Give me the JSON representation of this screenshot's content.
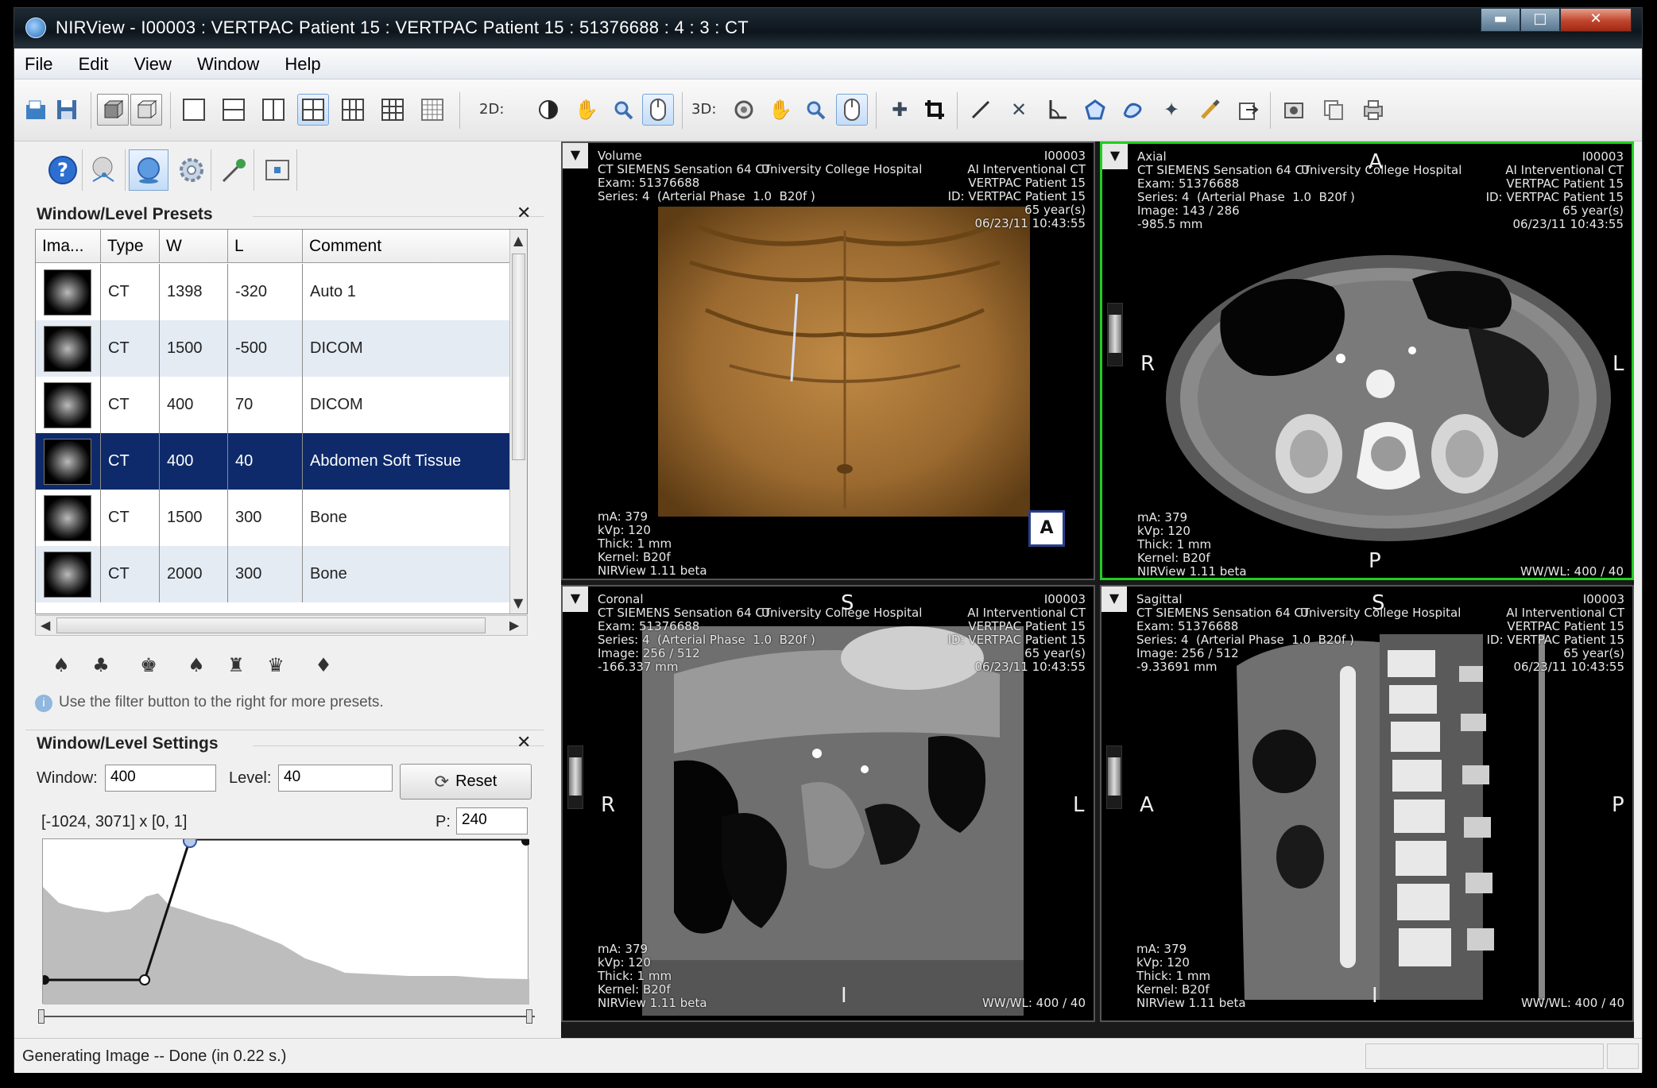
{
  "window": {
    "title": "NIRView - I00003 : VERTPAC Patient 15 : VERTPAC Patient 15 : 51376688 : 4  : 3  : CT"
  },
  "menu": [
    "File",
    "Edit",
    "View",
    "Window",
    "Help"
  ],
  "toolbar": {
    "label_2d": "2D:",
    "label_3d": "3D:"
  },
  "presets_panel": {
    "title": "Window/Level Presets",
    "columns": [
      "Ima...",
      "Type",
      "W",
      "L",
      "Comment"
    ],
    "rows": [
      {
        "type": "CT",
        "w": "1398",
        "l": "-320",
        "comment": "Auto 1"
      },
      {
        "type": "CT",
        "w": "1500",
        "l": "-500",
        "comment": "DICOM"
      },
      {
        "type": "CT",
        "w": "400",
        "l": "70",
        "comment": "DICOM"
      },
      {
        "type": "CT",
        "w": "400",
        "l": "40",
        "comment": "Abdomen Soft Tissue"
      },
      {
        "type": "CT",
        "w": "1500",
        "l": "300",
        "comment": "Bone"
      },
      {
        "type": "CT",
        "w": "2000",
        "l": "300",
        "comment": "Bone"
      }
    ],
    "selected_row": 3,
    "hint": "Use the filter button to the right for more presets."
  },
  "settings_panel": {
    "title": "Window/Level Settings",
    "window_label": "Window:",
    "window_value": "400",
    "level_label": "Level:",
    "level_value": "40",
    "reset_label": "Reset",
    "range_text": "[-1024, 3071] x [0, 1]",
    "p_label": "P:",
    "p_value": "240"
  },
  "viewports": {
    "volume": {
      "left": "Volume\nCT SIEMENS Sensation 64 CT\nExam: 51376688\nSeries: 4  (Arterial Phase  1.0  B20f )",
      "mid": "University College Hospital",
      "right": "I00003\nAI Interventional CT\nVERTPAC Patient 15\nID: VERTPAC Patient 15\n65 year(s)\n06/23/11 10:43:55",
      "bottom_left": "mA: 379\nkVp: 120\nThick: 1 mm\nKernel: B20f\nNIRView 1.11 beta",
      "badge": "A"
    },
    "axial": {
      "left": "Axial\nCT SIEMENS Sensation 64 CT\nExam: 51376688\nSeries: 4  (Arterial Phase  1.0  B20f )\nImage: 143 / 286\n-985.5 mm",
      "mid": "University College Hospital",
      "right": "I00003\nAI Interventional CT\nVERTPAC Patient 15\nID: VERTPAC Patient 15\n65 year(s)\n06/23/11 10:43:55",
      "bottom_left": "mA: 379\nkVp: 120\nThick: 1 mm\nKernel: B20f\nNIRView 1.11 beta",
      "bottom_right": "WW/WL: 400 / 40",
      "orient_top": "A",
      "orient_bottom": "P",
      "orient_left": "R",
      "orient_right": "L"
    },
    "coronal": {
      "left": "Coronal\nCT SIEMENS Sensation 64 CT\nExam: 51376688\nSeries: 4  (Arterial Phase  1.0  B20f )\nImage: 256 / 512\n-166.337 mm",
      "mid": "University College Hospital",
      "right": "I00003\nAI Interventional CT\nVERTPAC Patient 15\nID: VERTPAC Patient 15\n65 year(s)\n06/23/11 10:43:55",
      "bottom_left": "mA: 379\nkVp: 120\nThick: 1 mm\nKernel: B20f\nNIRView 1.11 beta",
      "bottom_right": "WW/WL: 400 / 40",
      "orient_top": "S",
      "orient_bottom": "I",
      "orient_left": "R",
      "orient_right": "L"
    },
    "sagittal": {
      "left": "Sagittal\nCT SIEMENS Sensation 64 CT\nExam: 51376688\nSeries: 4  (Arterial Phase  1.0  B20f )\nImage: 256 / 512\n-9.33691 mm",
      "mid": "University College Hospital",
      "right": "I00003\nAI Interventional CT\nVERTPAC Patient 15\nID: VERTPAC Patient 15\n65 year(s)\n06/23/11 10:43:55",
      "bottom_left": "mA: 379\nkVp: 120\nThick: 1 mm\nKernel: B20f\nNIRView 1.11 beta",
      "bottom_right": "WW/WL: 400 / 40",
      "orient_top": "S",
      "orient_bottom": "I",
      "orient_left": "A",
      "orient_right": "P"
    }
  },
  "status": {
    "text": "Generating Image -- Done (in 0.22 s.)"
  },
  "colors": {
    "active_viewport": "#20d020",
    "selection": "#0e2a6b",
    "alt_row": "#e4ebf3"
  },
  "icons": {
    "file_tools": [
      "open-icon",
      "save-icon"
    ],
    "left_tabs": [
      "help-icon",
      "transfer-function-icon",
      "volume-render-icon",
      "settings-gear-icon",
      "pin-icon",
      "snapshot-icon"
    ]
  }
}
